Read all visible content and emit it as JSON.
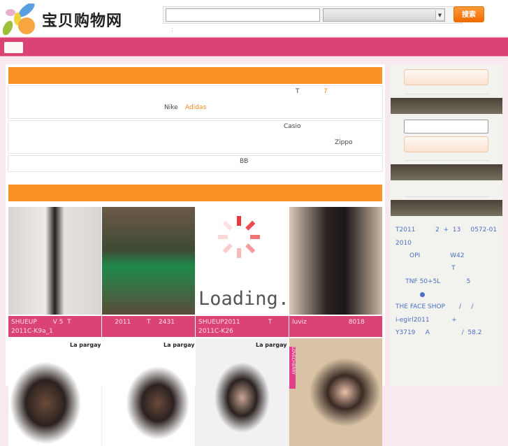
{
  "header": {
    "logo_text": "宝贝购物网",
    "search_button": "搜索",
    "search_value": "",
    "hint": ":"
  },
  "categories": {
    "row1": {
      "t": "T",
      "seven": "7",
      "nike": "Nike",
      "adidas": "Adidas"
    },
    "row2": {
      "casio": "Casio",
      "zippo": "Zippo"
    },
    "row3": {
      "bb": "BB"
    }
  },
  "products": [
    {
      "line1": "SHUEUP        V 5  T",
      "line2": "2011C-K9a_1"
    },
    {
      "line1": "     2011        T    2431",
      "line2": ""
    },
    {
      "line1": "SHUEUP2011              T",
      "line2": "2011C-K26"
    },
    {
      "line1": "luviz                     8018",
      "line2": ""
    }
  ],
  "loading_text": "Loading...",
  "brand_tag": "La pargay",
  "side_tag": "LOVECHERRY",
  "sidebar": {
    "login_value": "",
    "links": [
      "T2011          2  +  13     0572-01",
      "2010",
      "       OPI               W42",
      "                            T",
      "     TNF 50+5L             5",
      "THE FACE SHOP       /     /",
      "i-egirl2011           +",
      "Y3719     A                /  58.2"
    ]
  },
  "colors": {
    "accent": "#db4375",
    "orange": "#fb9227",
    "link": "#4d6fc2"
  }
}
